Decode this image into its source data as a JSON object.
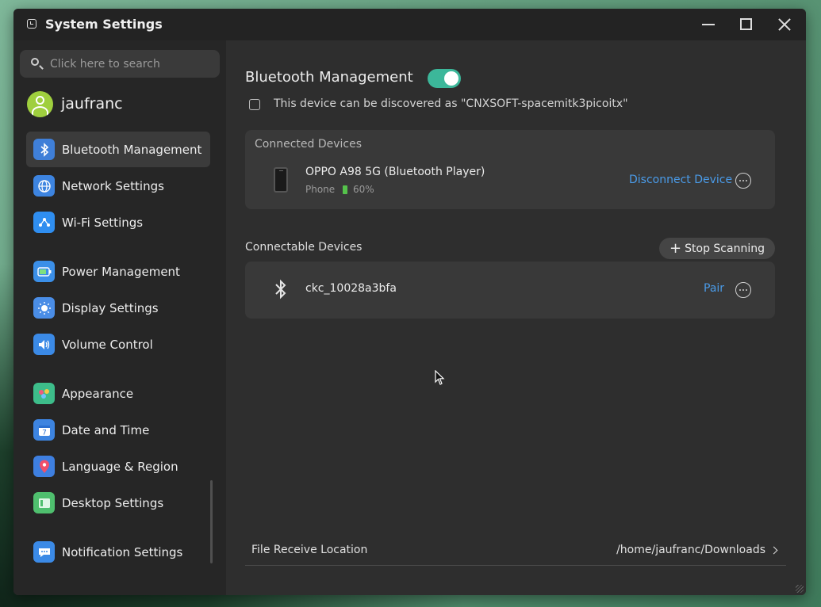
{
  "window": {
    "title": "System Settings"
  },
  "search": {
    "placeholder": "Click here to search"
  },
  "user": {
    "name": "jaufranc"
  },
  "sidebar": {
    "items": [
      {
        "label": "Bluetooth Management",
        "icon": "bluetooth-icon",
        "color": "#3f7fd8"
      },
      {
        "label": "Network Settings",
        "icon": "globe-icon",
        "color": "#3d84e0"
      },
      {
        "label": "Wi-Fi Settings",
        "icon": "wifi-icon",
        "color": "#2f8ef0"
      },
      {
        "label": "Power Management",
        "icon": "battery-icon",
        "color": "#3b8fe8"
      },
      {
        "label": "Display Settings",
        "icon": "brightness-icon",
        "color": "#4a8de6"
      },
      {
        "label": "Volume Control",
        "icon": "speaker-icon",
        "color": "#3b8ae6"
      },
      {
        "label": "Appearance",
        "icon": "palette-icon",
        "color": "#3dbd8a"
      },
      {
        "label": "Date and Time",
        "icon": "calendar-icon",
        "color": "#3d84e0"
      },
      {
        "label": "Language & Region",
        "icon": "map-pin-icon",
        "color": "#3e7fe0"
      },
      {
        "label": "Desktop Settings",
        "icon": "desktop-icon",
        "color": "#4fbf6e"
      },
      {
        "label": "Notification Settings",
        "icon": "chat-bubble-icon",
        "color": "#3b8ae6"
      }
    ]
  },
  "main": {
    "heading": "Bluetooth Management",
    "bluetooth_enabled": true,
    "discover_text": "This device can be discovered as \"CNXSOFT-spacemitk3picoitx\"",
    "connected": {
      "title": "Connected Devices",
      "device_name": "OPPO A98 5G (Bluetooth Player)",
      "device_type": "Phone",
      "battery": "60%",
      "action": "Disconnect Device"
    },
    "connectable": {
      "title": "Connectable Devices",
      "scan_label": "Stop Scanning",
      "device_name": "ckc_10028a3bfa",
      "action": "Pair"
    },
    "file_receive": {
      "label": "File Receive Location",
      "path": "/home/jaufranc/Downloads"
    }
  },
  "colors": {
    "accent": "#3cb79a",
    "link": "#4a9be8"
  }
}
